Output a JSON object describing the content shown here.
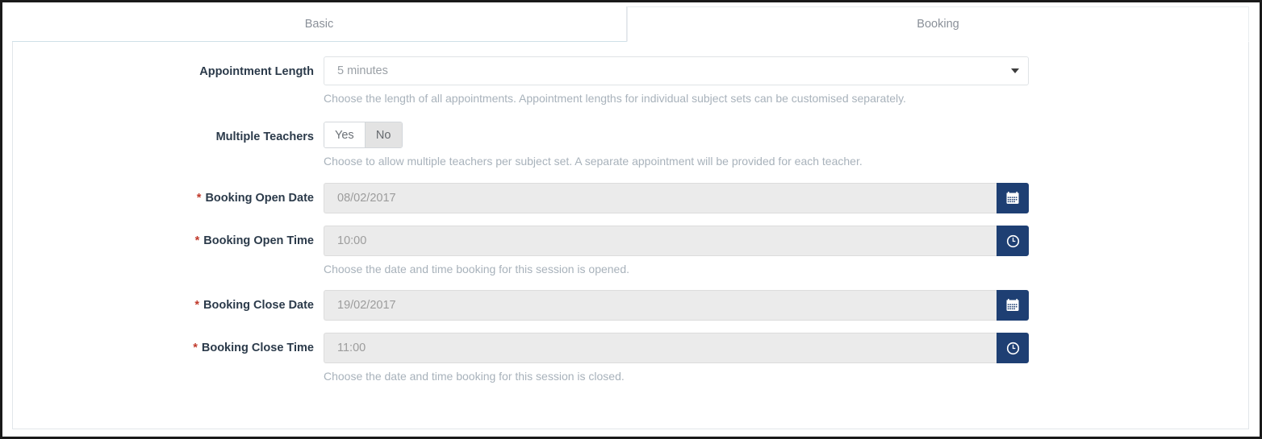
{
  "window": {
    "tabs": [
      {
        "label": "Basic",
        "active": false
      },
      {
        "label": "Booking",
        "active": true
      }
    ]
  },
  "form": {
    "appointment_length": {
      "label": "Appointment Length",
      "value": "5 minutes",
      "help": "Choose the length of all appointments. Appointment lengths for individual subject sets can be customised separately.",
      "caret_icon": "chevron-down-icon"
    },
    "multiple_teachers": {
      "label": "Multiple Teachers",
      "options": [
        {
          "label": "Yes",
          "selected": false
        },
        {
          "label": "No",
          "selected": true
        }
      ],
      "help": "Choose to allow multiple teachers per subject set. A separate appointment will be provided for each teacher."
    },
    "booking_open_date": {
      "label": "Booking Open Date",
      "required_marker": "*",
      "value": "08/02/2017",
      "addon_icon": "calendar-icon"
    },
    "booking_open_time": {
      "label": "Booking Open Time",
      "required_marker": "*",
      "value": "10:00",
      "addon_icon": "clock-icon",
      "help": "Choose the date and time booking for this session is opened."
    },
    "booking_close_date": {
      "label": "Booking Close Date",
      "required_marker": "*",
      "value": "19/02/2017",
      "addon_icon": "calendar-icon"
    },
    "booking_close_time": {
      "label": "Booking Close Time",
      "required_marker": "*",
      "value": "11:00",
      "addon_icon": "clock-icon",
      "help": "Choose the date and time booking for this session is closed."
    }
  },
  "colors": {
    "addon_blue": "#1e3f73",
    "required_red": "#c0392b",
    "label_navy": "#2b3a4a",
    "help_grey": "#a8b2bb"
  }
}
